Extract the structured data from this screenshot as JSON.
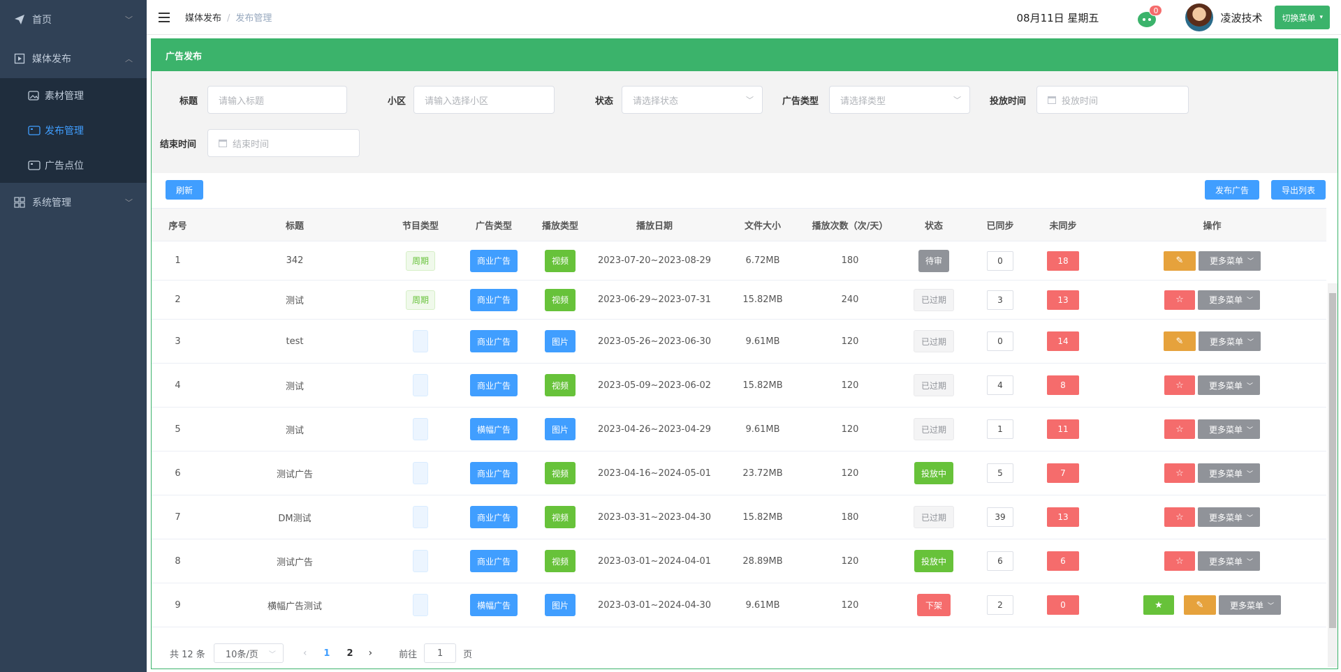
{
  "sidebar": {
    "items": [
      {
        "label": "首页",
        "icon": "send-icon"
      },
      {
        "label": "媒体发布",
        "icon": "media-icon",
        "children": [
          {
            "label": "素材管理",
            "icon": "image-icon"
          },
          {
            "label": "发布管理",
            "icon": "video-icon",
            "active": true
          },
          {
            "label": "广告点位",
            "icon": "video-icon"
          }
        ]
      },
      {
        "label": "系统管理",
        "icon": "grid-icon"
      }
    ]
  },
  "header": {
    "breadcrumb": [
      "媒体发布",
      "发布管理"
    ],
    "date": "08月11日 星期五",
    "message_count": "0",
    "username": "凌波技术",
    "switch_label": "切换菜单"
  },
  "panel": {
    "title": "广告发布"
  },
  "filters": {
    "title": {
      "label": "标题",
      "placeholder": "请输入标题"
    },
    "community": {
      "label": "小区",
      "placeholder": "请输入选择小区"
    },
    "status": {
      "label": "状态",
      "placeholder": "请选择状态"
    },
    "ad_type": {
      "label": "广告类型",
      "placeholder": "请选择类型"
    },
    "start_time": {
      "label": "投放时间",
      "placeholder": "投放时间"
    },
    "end_time": {
      "label": "结束时间",
      "placeholder": "结束时间"
    }
  },
  "toolbar": {
    "refresh": "刷新",
    "publish": "发布广告",
    "export": "导出列表"
  },
  "table": {
    "headers": [
      "序号",
      "标题",
      "节目类型",
      "广告类型",
      "播放类型",
      "播放日期",
      "文件大小",
      "播放次数（次/天）",
      "状态",
      "已同步",
      "未同步",
      "操作"
    ],
    "more_label": "更多菜单",
    "rows": [
      {
        "no": "1",
        "title": "342",
        "program": "周期",
        "ad_type": "商业广告",
        "play_type": "视频",
        "date": "2023-07-20~2023-08-29",
        "size": "6.72MB",
        "times": "180",
        "status": "待审",
        "synced": "0",
        "unsynced": "18",
        "ops": "edit"
      },
      {
        "no": "2",
        "title": "测试",
        "program": "周期",
        "ad_type": "商业广告",
        "play_type": "视频",
        "date": "2023-06-29~2023-07-31",
        "size": "15.82MB",
        "times": "240",
        "status": "已过期",
        "synced": "3",
        "unsynced": "13",
        "ops": "star"
      },
      {
        "no": "3",
        "title": "test",
        "program": "",
        "ad_type": "商业广告",
        "play_type": "图片",
        "date": "2023-05-26~2023-06-30",
        "size": "9.61MB",
        "times": "120",
        "status": "已过期",
        "synced": "0",
        "unsynced": "14",
        "ops": "edit"
      },
      {
        "no": "4",
        "title": "测试",
        "program": "",
        "ad_type": "商业广告",
        "play_type": "视频",
        "date": "2023-05-09~2023-06-02",
        "size": "15.82MB",
        "times": "120",
        "status": "已过期",
        "synced": "4",
        "unsynced": "8",
        "ops": "star"
      },
      {
        "no": "5",
        "title": "测试",
        "program": "",
        "ad_type": "横幅广告",
        "play_type": "图片",
        "date": "2023-04-26~2023-04-29",
        "size": "9.61MB",
        "times": "120",
        "status": "已过期",
        "synced": "1",
        "unsynced": "11",
        "ops": "star"
      },
      {
        "no": "6",
        "title": "测试广告",
        "program": "",
        "ad_type": "商业广告",
        "play_type": "视频",
        "date": "2023-04-16~2024-05-01",
        "size": "23.72MB",
        "times": "120",
        "status": "投放中",
        "synced": "5",
        "unsynced": "7",
        "ops": "star"
      },
      {
        "no": "7",
        "title": "DM测试",
        "program": "",
        "ad_type": "商业广告",
        "play_type": "视频",
        "date": "2023-03-31~2023-04-30",
        "size": "15.82MB",
        "times": "180",
        "status": "已过期",
        "synced": "39",
        "unsynced": "13",
        "ops": "star"
      },
      {
        "no": "8",
        "title": "测试广告",
        "program": "",
        "ad_type": "商业广告",
        "play_type": "视频",
        "date": "2023-03-01~2024-04-01",
        "size": "28.89MB",
        "times": "120",
        "status": "投放中",
        "synced": "6",
        "unsynced": "6",
        "ops": "star"
      },
      {
        "no": "9",
        "title": "横幅广告测试",
        "program": "",
        "ad_type": "横幅广告",
        "play_type": "图片",
        "date": "2023-03-01~2024-04-30",
        "size": "9.61MB",
        "times": "120",
        "status": "下架",
        "synced": "2",
        "unsynced": "0",
        "ops": "star-edit"
      }
    ]
  },
  "pagination": {
    "total": "共 12 条",
    "page_size": "10条/页",
    "pages": [
      "1",
      "2"
    ],
    "current": "1",
    "goto_prefix": "前往",
    "goto_value": "1",
    "goto_suffix": "页"
  },
  "colors": {
    "sidebar_bg": "#304156",
    "accent_green": "#3bb36b",
    "primary_blue": "#409eff",
    "danger": "#f56c6c",
    "warning": "#e6a23c"
  }
}
